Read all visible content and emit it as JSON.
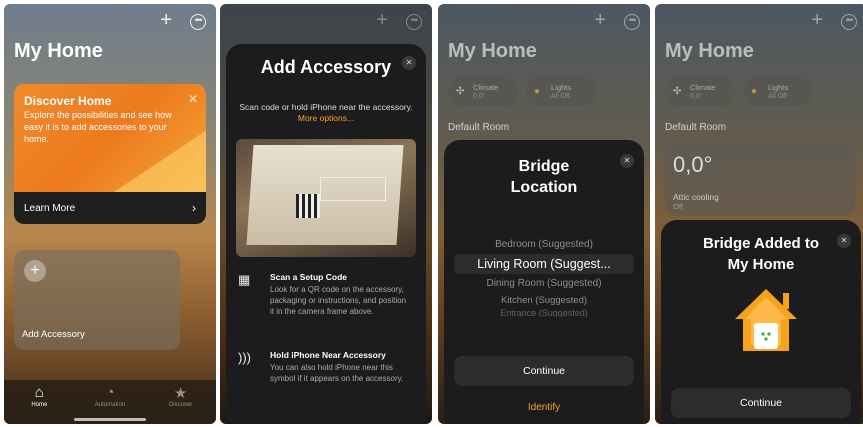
{
  "screen1": {
    "title": "My Home",
    "discover_title": "Discover Home",
    "discover_text": "Explore the possibilities and see how easy it is to add accessories to your home.",
    "learn_more": "Learn More",
    "add_accessory": "Add Accessory",
    "tabs": [
      {
        "label": "Home"
      },
      {
        "label": "Automation"
      },
      {
        "label": "Discover"
      }
    ]
  },
  "screen2": {
    "title": "Add Accessory",
    "subtitle": "Scan code or hold iPhone near the accessory.",
    "more_options": "More options...",
    "scan_title": "Scan a Setup Code",
    "scan_desc": "Look for a QR code on the accessory, packaging or instructions, and position it in the camera frame above.",
    "nfc_title": "Hold iPhone Near Accessory",
    "nfc_desc": "You can also hold iPhone near this symbol if it appears on the accessory."
  },
  "screen3": {
    "title": "My Home",
    "chips": [
      {
        "label": "Climate",
        "value": "0,0°"
      },
      {
        "label": "Lights",
        "value": "All Off"
      }
    ],
    "room_label": "Default Room",
    "sheet_title": "Bridge Location",
    "rooms": [
      "Bedroom (Suggested)",
      "Living Room (Suggest...",
      "Dining Room (Suggested)",
      "Kitchen (Suggested)",
      "Entrance (Suggested)"
    ],
    "continue": "Continue",
    "identify": "Identify"
  },
  "screen4": {
    "title": "My Home",
    "chips": [
      {
        "label": "Climate",
        "value": "0,0°"
      },
      {
        "label": "Lights",
        "value": "All Off"
      }
    ],
    "room_label": "Default Room",
    "temp": "0,0°",
    "tile_name": "Attic cooling",
    "tile_status": "Off",
    "sheet_title": "Bridge Added to My Home",
    "continue": "Continue"
  },
  "colors": {
    "accent": "#f7a21b",
    "sheet": "#1c1c1e",
    "discover": "#ed7a1f"
  }
}
